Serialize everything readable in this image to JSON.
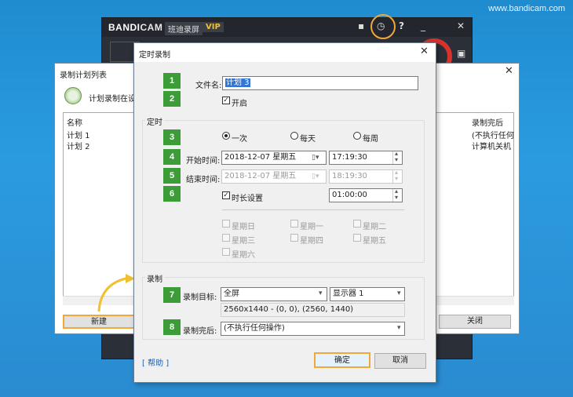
{
  "watermark": "www.bandicam.com",
  "bandicam": {
    "logo_main": "BANDI",
    "logo_cam": "CAM",
    "tag": "班迪录屏",
    "vip": "VIP",
    "icons": [
      "folder-icon",
      "clock-icon",
      "help-icon",
      "minimize-icon",
      "close-icon",
      "camera-icon"
    ]
  },
  "schedule_list": {
    "title": "录制计划列表",
    "subtitle": "计划录制在设置",
    "columns": [
      "名称",
      "录制完后"
    ],
    "rows": [
      {
        "name": "计划 1",
        "after": "(不执行任何"
      },
      {
        "name": "计划 2",
        "after": "计算机关机"
      }
    ],
    "new_label": "新建",
    "close_label": "关闭"
  },
  "dialog": {
    "title": "定时录制",
    "filename_label": "文件名:",
    "filename_value": "计划 3",
    "enable_label": "开启",
    "enable_checked": true,
    "timing_group": "定时",
    "radio_options": [
      "一次",
      "每天",
      "每周"
    ],
    "radio_selected": "一次",
    "start_label": "开始时间:",
    "start_date": "2018-12-07 星期五",
    "start_time": "17:19:30",
    "end_label": "结束时间:",
    "end_date": "2018-12-07 星期五",
    "end_time": "18:19:30",
    "duration_label": "时长设置",
    "duration_checked": true,
    "duration_value": "01:00:00",
    "weekdays": [
      "星期日",
      "星期一",
      "星期二",
      "星期三",
      "星期四",
      "星期五",
      "星期六"
    ],
    "record_group": "录制",
    "target_label": "录制目标:",
    "target_value": "全屏",
    "monitor_value": "显示器 1",
    "resolution_text": "2560x1440 - (0, 0), (2560, 1440)",
    "after_label": "录制完后:",
    "after_value": "(不执行任何操作)",
    "help_label": "[ 帮助 ]",
    "ok_label": "确定",
    "cancel_label": "取消",
    "step_numbers": [
      "1",
      "2",
      "3",
      "4",
      "5",
      "6",
      "7",
      "8"
    ]
  },
  "colors": {
    "step_badge": "#3c9c37",
    "highlight": "#f0a838",
    "record_red": "#d7322c",
    "selection": "#3175d6"
  }
}
